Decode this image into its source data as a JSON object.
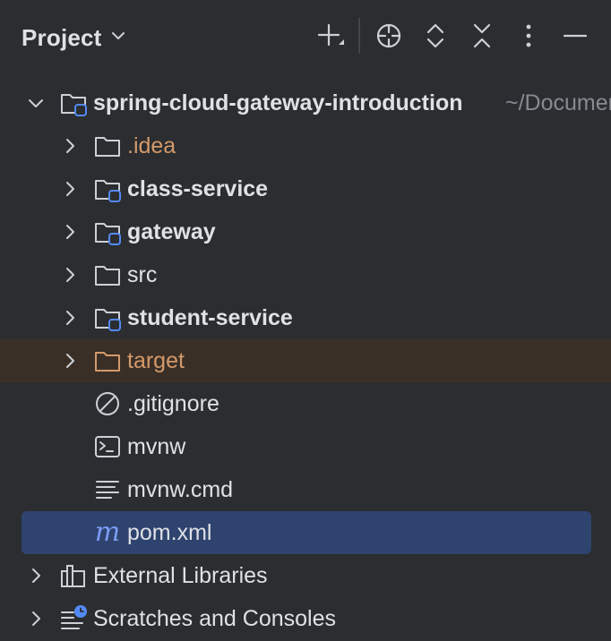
{
  "header": {
    "title": "Project",
    "toolbar": [
      {
        "name": "add-icon"
      },
      {
        "name": "locate-icon"
      },
      {
        "name": "expand-all-icon"
      },
      {
        "name": "collapse-all-icon"
      },
      {
        "name": "more-options-icon"
      },
      {
        "name": "minimize-icon"
      }
    ]
  },
  "tree": {
    "root": {
      "label": "spring-cloud-gateway-introduction",
      "hint": "~/Documents"
    },
    "items": [
      {
        "label": ".idea"
      },
      {
        "label": "class-service"
      },
      {
        "label": "gateway"
      },
      {
        "label": "src"
      },
      {
        "label": "student-service"
      },
      {
        "label": "target"
      },
      {
        "label": ".gitignore"
      },
      {
        "label": "mvnw"
      },
      {
        "label": "mvnw.cmd"
      },
      {
        "label": "pom.xml"
      }
    ],
    "external_libraries": {
      "label": "External Libraries"
    },
    "scratches": {
      "label": "Scratches and Consoles"
    }
  },
  "colors": {
    "background": "#2b2d30",
    "text": "#dfe1e5",
    "muted": "#868a91",
    "excluded_text": "#d49a6a",
    "excluded_row": "#3a2f27",
    "selection": "#2e436e",
    "module_badge": "#548af7"
  }
}
